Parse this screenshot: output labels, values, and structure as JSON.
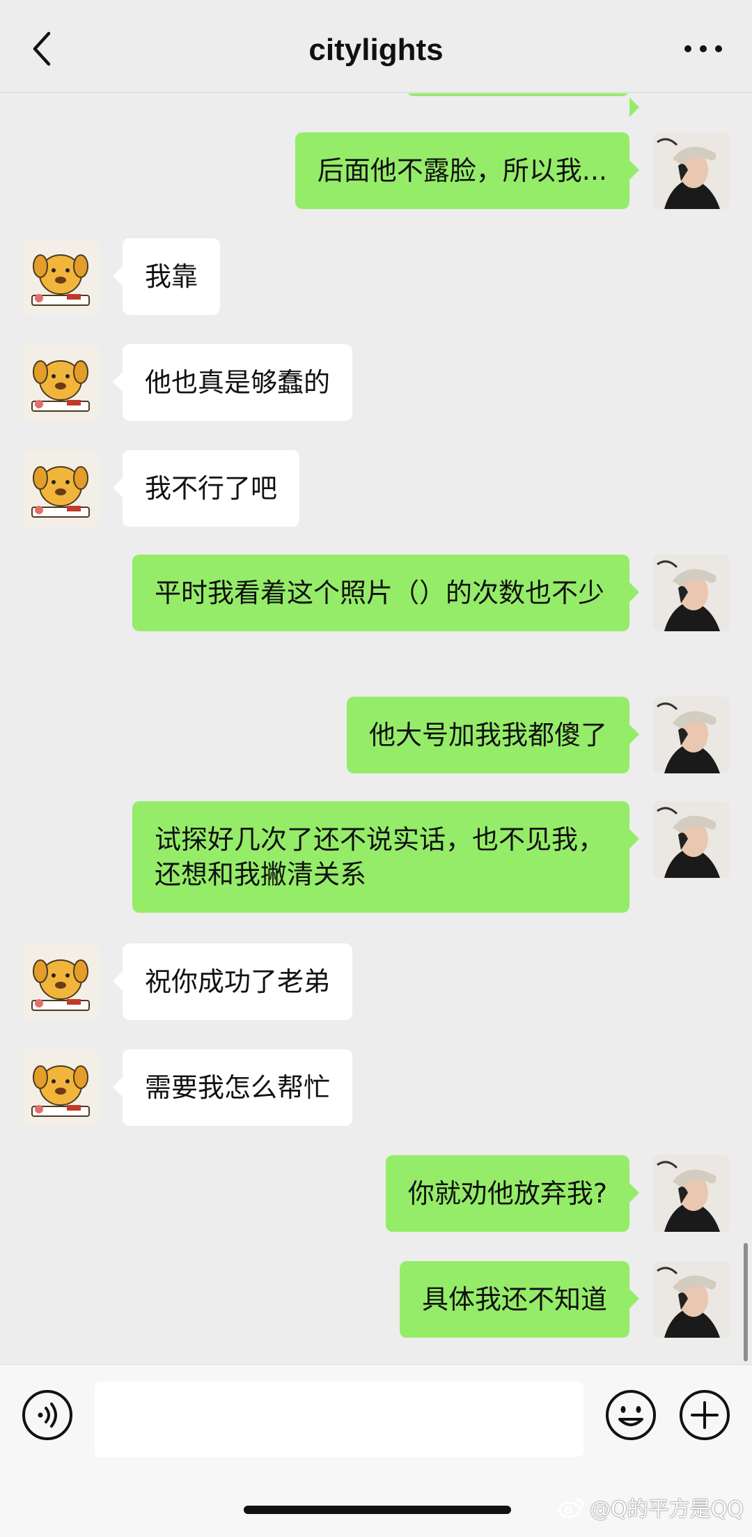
{
  "header": {
    "title": "citylights"
  },
  "colors": {
    "sent_bubble": "#95ec69",
    "received_bubble": "#ffffff",
    "background": "#ededed"
  },
  "messages": [
    {
      "side": "right",
      "text": "后面他不露脸，所以我..."
    },
    {
      "side": "left",
      "text": "我靠"
    },
    {
      "side": "left",
      "text": "他也真是够蠢的"
    },
    {
      "side": "left",
      "text": "我不行了吧"
    },
    {
      "side": "right",
      "text": "平时我看着这个照片（）的次数也不少"
    },
    {
      "side": "right",
      "text": "他大号加我我都傻了"
    },
    {
      "side": "right",
      "text": "试探好几次了还不说实话，也不见我，还想和我撇清关系"
    },
    {
      "side": "left",
      "text": "祝你成功了老弟"
    },
    {
      "side": "left",
      "text": "需要我怎么帮忙"
    },
    {
      "side": "right",
      "text": "你就劝他放弃我?"
    },
    {
      "side": "right",
      "text": "具体我还不知道"
    }
  ],
  "watermark": {
    "text": "@Q的平方是QQ"
  },
  "icons": {
    "back": "chevron-left-icon",
    "more": "more-dots-icon",
    "voice": "voice-icon",
    "emoji": "emoji-icon",
    "plus": "plus-icon",
    "watermark": "weibo-logo-icon"
  }
}
